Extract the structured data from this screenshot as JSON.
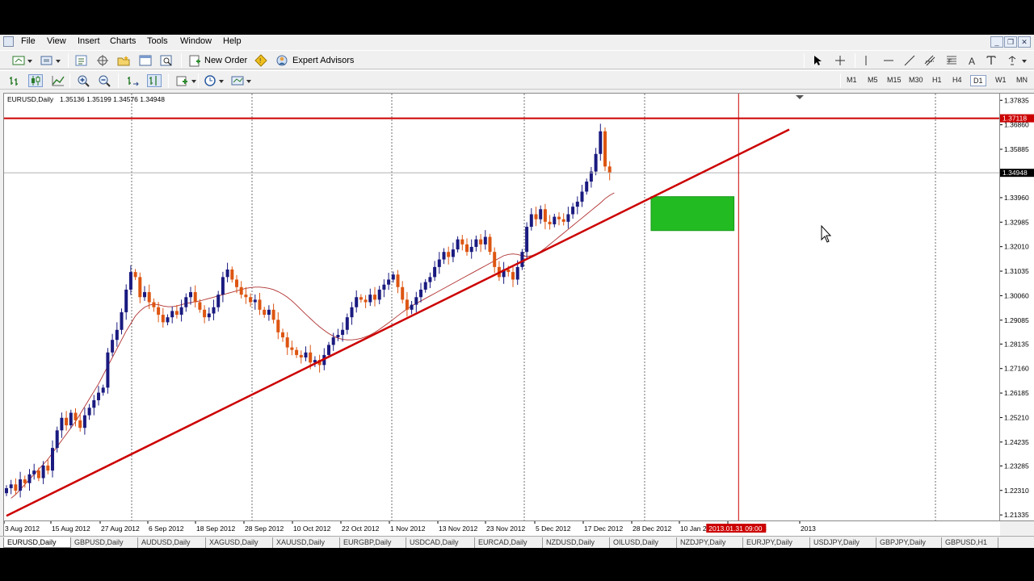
{
  "menu": [
    "File",
    "View",
    "Insert",
    "Charts",
    "Tools",
    "Window",
    "Help"
  ],
  "toolbar": {
    "new_order": "New Order",
    "expert_advisors": "Expert Advisors",
    "timeframes": [
      "M1",
      "M5",
      "M15",
      "M30",
      "H1",
      "H4",
      "D1",
      "W1",
      "MN"
    ],
    "active_timeframe": "D1"
  },
  "chart": {
    "symbol_label": "EURUSD,Daily",
    "ohlc": "1.35136 1.35199 1.34576 1.34948",
    "hline_label": "1.37118",
    "current_price_label": "1.34948",
    "crosshair_date_label": "2013.01.31 09:00"
  },
  "chart_data": {
    "type": "candlestick",
    "symbol": "EURUSD",
    "timeframe": "Daily",
    "ylim": [
      1.2105,
      1.381
    ],
    "price_ticks": [
      "1.37835",
      "1.36860",
      "1.35885",
      "1.34910",
      "1.33960",
      "1.32985",
      "1.32010",
      "1.31035",
      "1.30060",
      "1.29085",
      "1.28135",
      "1.27160",
      "1.26185",
      "1.25210",
      "1.24235",
      "1.23285",
      "1.22310",
      "1.21335"
    ],
    "date_ticks": [
      "3 Aug 2012",
      "15 Aug 2012",
      "27 Aug 2012",
      "6 Sep 2012",
      "18 Sep 2012",
      "28 Sep 2012",
      "10 Oct 2012",
      "22 Oct 2012",
      "1 Nov 2012",
      "13 Nov 2012",
      "23 Nov 2012",
      "5 Dec 2012",
      "17 Dec 2012",
      "28 Dec 2012",
      "10 Jan 2013",
      "22 Jan 2013",
      "2013"
    ],
    "horizontal_line": 1.37118,
    "current_price": 1.34948,
    "trendline": {
      "from": [
        0,
        1.213
      ],
      "to": [
        170,
        1.3667
      ]
    },
    "rectangle": {
      "x_from": 140,
      "x_to": 158,
      "y_from": 1.3265,
      "y_to": 1.34
    },
    "moving_average": [
      1.22,
      1.2215,
      1.2235,
      1.2255,
      1.2275,
      1.2295,
      1.2315,
      1.2335,
      1.2355,
      1.238,
      1.2405,
      1.243,
      1.2455,
      1.248,
      1.2505,
      1.2535,
      1.2565,
      1.2595,
      1.2625,
      1.2655,
      1.269,
      1.2725,
      1.276,
      1.2795,
      1.283,
      1.2865,
      1.2895,
      1.2925,
      1.2945,
      1.296,
      1.2968,
      1.2972,
      1.297,
      1.2965,
      1.2962,
      1.2962,
      1.2965,
      1.297,
      1.2975,
      1.2978,
      1.2982,
      1.2985,
      1.299,
      1.2995,
      1.3,
      1.3005,
      1.301,
      1.3015,
      1.302,
      1.3025,
      1.303,
      1.3035,
      1.3038,
      1.304,
      1.304,
      1.3038,
      1.3035,
      1.303,
      1.3022,
      1.3012,
      1.3,
      1.2985,
      1.2968,
      1.295,
      1.2932,
      1.2915,
      1.2898,
      1.2882,
      1.2868,
      1.2855,
      1.2845,
      1.2837,
      1.2832,
      1.283,
      1.283,
      1.2832,
      1.2836,
      1.2842,
      1.285,
      1.286,
      1.2872,
      1.2885,
      1.2898,
      1.2912,
      1.2926,
      1.294,
      1.2953,
      1.2965,
      1.2975,
      1.2985,
      1.2995,
      1.3005,
      1.3015,
      1.3025,
      1.3035,
      1.3045,
      1.3055,
      1.3065,
      1.3075,
      1.3085,
      1.3095,
      1.3105,
      1.3115,
      1.3125,
      1.3135,
      1.3145,
      1.3155,
      1.3165,
      1.317,
      1.3172,
      1.317,
      1.3165,
      1.3162,
      1.3165,
      1.3172,
      1.3182,
      1.3195,
      1.321,
      1.3225,
      1.324,
      1.3255,
      1.327,
      1.3285,
      1.33,
      1.3315,
      1.333,
      1.3345,
      1.336,
      1.3375,
      1.3392,
      1.3405,
      1.3415
    ]
  },
  "tabs": [
    "EURUSD,Daily",
    "GBPUSD,Daily",
    "AUDUSD,Daily",
    "XAGUSD,Daily",
    "XAUUSD,Daily",
    "EURGBP,Daily",
    "USDCAD,Daily",
    "EURCAD,Daily",
    "NZDUSD,Daily",
    "OILUSD,Daily",
    "NZDJPY,Daily",
    "EURJPY,Daily",
    "USDJPY,Daily",
    "GBPJPY,Daily",
    "GBPUSD,H1"
  ]
}
